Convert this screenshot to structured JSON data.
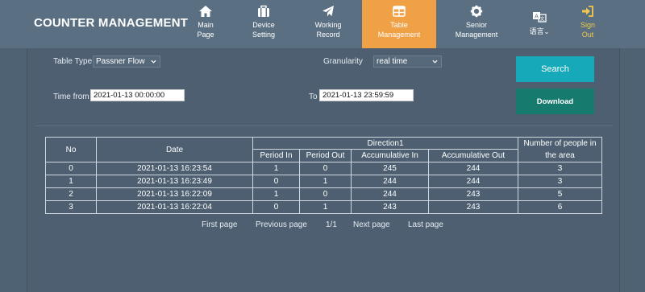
{
  "brand": "COUNTER MANAGEMENT",
  "nav": [
    {
      "line1": "Main",
      "line2": "Page",
      "icon": "home-icon"
    },
    {
      "line1": "Device",
      "line2": "Setting",
      "icon": "briefcase-icon"
    },
    {
      "line1": "Working",
      "line2": "Record",
      "icon": "paper-plane-icon"
    },
    {
      "line1": "Table",
      "line2": "Management",
      "icon": "table-icon"
    },
    {
      "line1": "Senior",
      "line2": "Management",
      "icon": "gear-icon"
    },
    {
      "line1": "语言",
      "line2": "",
      "icon": "translate-icon"
    },
    {
      "line1": "Sign",
      "line2": "Out",
      "icon": "sign-out-icon"
    }
  ],
  "colors": {
    "active_tab": "#f0a045",
    "sign_out": "#f1c84a",
    "search_button": "#16a9b9",
    "download_button": "#177a6e"
  },
  "filters": {
    "table_type_label": "Table Type",
    "table_type_value": "Passner Flow",
    "granularity_label": "Granularity",
    "granularity_value": "real time",
    "time_from_label": "Time from",
    "time_from_value": "2021-01-13 00:00:00",
    "to_label": "To",
    "to_value": "2021-01-13 23:59:59"
  },
  "buttons": {
    "search": "Search",
    "download": "Download"
  },
  "table": {
    "headers": {
      "no": "No",
      "date": "Date",
      "group": "Direction1",
      "period_in": "Period In",
      "period_out": "Period Out",
      "accum_in": "Accumulative In",
      "accum_out": "Accumulative Out",
      "people": "Number of people in the area"
    },
    "rows": [
      [
        "0",
        "2021-01-13 16:23:54",
        "1",
        "0",
        "245",
        "244",
        "3"
      ],
      [
        "1",
        "2021-01-13 16:23:49",
        "0",
        "1",
        "244",
        "244",
        "3"
      ],
      [
        "2",
        "2021-01-13 16:22:09",
        "1",
        "0",
        "244",
        "243",
        "5"
      ],
      [
        "3",
        "2021-01-13 16:22:04",
        "0",
        "1",
        "243",
        "243",
        "6"
      ]
    ]
  },
  "pager": {
    "first": "First page",
    "prev": "Previous page",
    "info": "1/1",
    "next": "Next page",
    "last": "Last page"
  }
}
